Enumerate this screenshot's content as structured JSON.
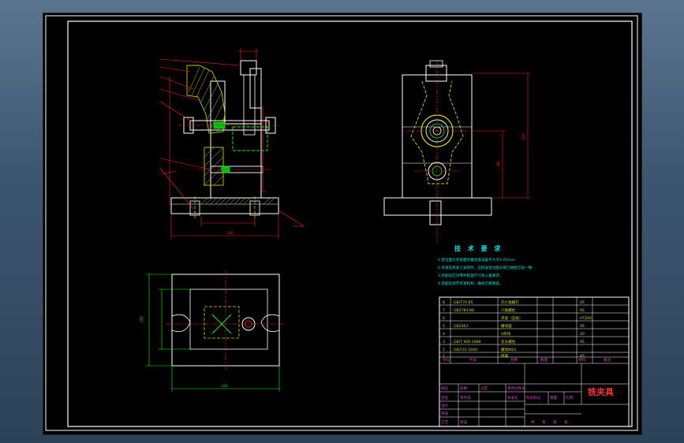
{
  "drawing": {
    "title_block_name": "铣夹具",
    "technical_requirements": {
      "heading": "技 术 要 求",
      "lines": [
        "1.定位面与夹紧面的垂直度误差不大于0.05mm;",
        "2.夹具在机床上安装时，应校准定位面与铣刀进给方向一致;",
        "3.装配前应对零件检查尺寸及公差要求;",
        "4.装配后调节夹紧机构，确保可靠锁紧。"
      ]
    },
    "bom_rows": [
      {
        "no": "8",
        "code": "GB/T70-85",
        "name": "内六角螺钉",
        "qty": "",
        "material": "45"
      },
      {
        "no": "7",
        "code": "GB5783-86",
        "name": "六角螺栓",
        "qty": "",
        "material": "45"
      },
      {
        "no": "6",
        "code": "",
        "name": "夹紧（压板）",
        "qty": "",
        "material": "HT200"
      },
      {
        "no": "5",
        "code": "GB2362",
        "name": "螺母座",
        "qty": "",
        "material": "45"
      },
      {
        "no": "4",
        "code": "",
        "name": "V形块",
        "qty": "",
        "material": "20"
      },
      {
        "no": "3",
        "code": "GB/T 900-1988",
        "name": "双头螺柱",
        "qty": "",
        "material": "45"
      },
      {
        "no": "2",
        "code": "GB/T41-2000",
        "name": "螺母M16",
        "qty": "",
        "material": ""
      },
      {
        "no": "1",
        "code": "",
        "name": "底座",
        "qty": "",
        "material": "45"
      }
    ],
    "bom_header": [
      "序号",
      "代号",
      "名称",
      "数量",
      "材料",
      "备注"
    ],
    "title_block_labels": [
      "标记",
      "处数",
      "分区",
      "更改文件号",
      "签名",
      "年月日",
      "设计",
      "审核",
      "工艺",
      "批准",
      "标准化",
      "阶段标记",
      "重量",
      "比例",
      "共",
      "张",
      "第",
      "张"
    ],
    "dimension_labels": [
      "180",
      "155",
      "120",
      "220",
      "185"
    ]
  }
}
